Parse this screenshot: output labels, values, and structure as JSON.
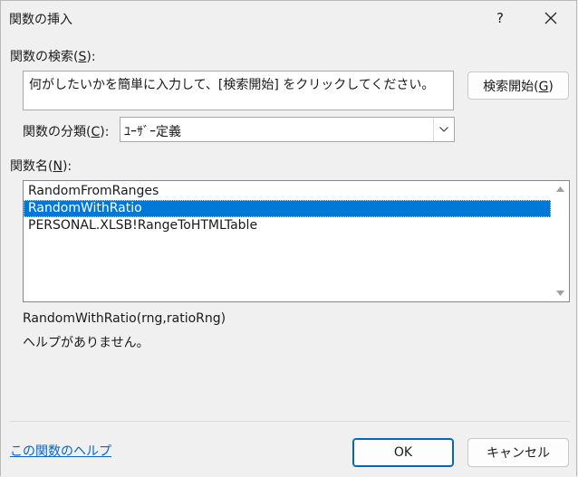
{
  "window": {
    "title": "関数の挿入",
    "help_label": "?",
    "close_icon": "close-icon"
  },
  "search": {
    "label_pre": "関数の検索(",
    "label_key": "S",
    "label_post": "):",
    "placeholder": "何がしたいかを簡単に入力して、[検索開始] をクリックしてください。",
    "button_pre": "検索開始(",
    "button_key": "G",
    "button_post": ")"
  },
  "category": {
    "label_pre": "関数の分類(",
    "label_key": "C",
    "label_post": "):",
    "selected": "ﾕｰｻﾞｰ定義",
    "arrow_icon": "chevron-down-icon"
  },
  "functions": {
    "label_pre": "関数名(",
    "label_key": "N",
    "label_post": "):",
    "items": [
      "RandomFromRanges",
      "RandomWithRatio",
      "PERSONAL.XLSB!RangeToHTMLTable"
    ],
    "selected_index": 1
  },
  "details": {
    "signature": "RandomWithRatio(rng,ratioRng)",
    "description": "ヘルプがありません。"
  },
  "footer": {
    "help_link": "この関数のヘルプ",
    "ok_label": "OK",
    "cancel_label": "キャンセル"
  },
  "colors": {
    "selection": "#0078d7",
    "link": "#0066cc",
    "primary_border": "#0067c0"
  }
}
